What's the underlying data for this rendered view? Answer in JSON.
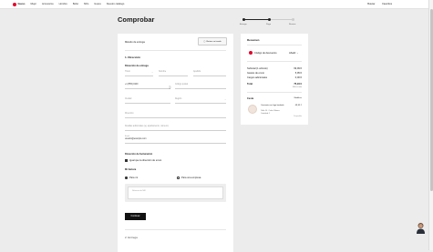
{
  "nav": {
    "brand": "Guess",
    "items": [
      "Mujer",
      "Accesorios",
      "Hombre",
      "Bebé",
      "Niño",
      "Guess",
      "Nuestro catálogo"
    ],
    "right": [
      "Buscar",
      "Favoritos"
    ]
  },
  "page": {
    "title": "Comprobar"
  },
  "steps": [
    "Entrega",
    "Pago",
    "Revisar"
  ],
  "left": {
    "method_label": "Método de entrega",
    "pickup_btn": "Retirar en tienda",
    "section1": "1. Dirección",
    "delivery_address": "Dirección de entrega",
    "fields": {
      "title": "Título",
      "name": "Nombre",
      "surname": "Apellido",
      "phone_value": "+1 (555) 0100",
      "code": "Código",
      "postal": "Código postal",
      "city": "Ciudad",
      "region": "Región",
      "address": "Dirección",
      "address_extra": "Detalles adicionales (ej. apartamento, número)",
      "email_label": "Email",
      "email_value": "usuario@example.com"
    },
    "billing_label": "Dirección de facturación",
    "billing_same": "Igual que la dirección de envío",
    "gift_label": "Mi factura",
    "gift_opt1": "Para mí",
    "gift_opt2": "Para una empresa",
    "note_placeholder": "Número de NIF",
    "continue_btn": "Continuar",
    "section2": "2. Entrega"
  },
  "summary": {
    "title": "Resumen",
    "promo": "Código de descuento",
    "promo_value": "Añadir",
    "rows": [
      {
        "label": "Subtotal (1 artículo)",
        "value": "69,99 €"
      },
      {
        "label": "Gastos de envío",
        "value": "5,95 €"
      },
      {
        "label": "Cargos adicionales",
        "value": "0,00 €"
      }
    ],
    "total_label": "Total",
    "total_value": "75,94 €",
    "total_note": "IVA incluido",
    "cart_label": "Cesta",
    "cart_edit": "Modificar",
    "item_name": "Camiseta con logo bordado",
    "item_details": "Talla: M · Color: Blanco",
    "item_qty": "Cantidad: 1",
    "item_price": "69,99 €",
    "item_tag": "Disponible"
  },
  "colors": {
    "accent": "#e4002b",
    "button": "#111111"
  }
}
